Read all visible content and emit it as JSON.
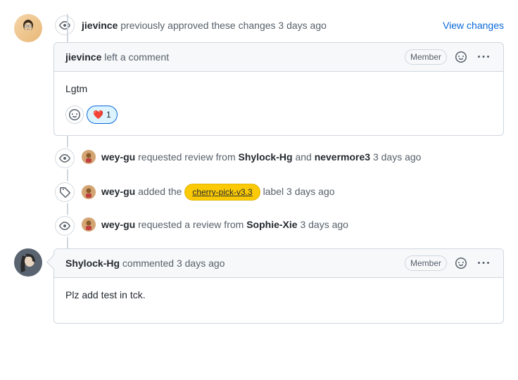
{
  "review1": {
    "user": "jievince",
    "action": "previously approved these changes",
    "timestamp": "3 days ago",
    "view_changes": "View changes",
    "comment_action": "left a comment",
    "member_label": "Member",
    "body": "Lgtm",
    "reaction_emoji": "❤️",
    "reaction_count": "1"
  },
  "event1": {
    "user": "wey-gu",
    "action_pre": "requested review from",
    "reviewers": [
      "Shylock-Hg",
      "nevermore3"
    ],
    "and": "and",
    "timestamp": "3 days ago"
  },
  "event2": {
    "user": "wey-gu",
    "action_pre": "added the",
    "label_name": "cherry-pick-v3.3",
    "action_post": "label",
    "timestamp": "3 days ago"
  },
  "event3": {
    "user": "wey-gu",
    "action_pre": "requested a review from",
    "reviewer": "Sophie-Xie",
    "timestamp": "3 days ago"
  },
  "comment2": {
    "user": "Shylock-Hg",
    "action": "commented",
    "timestamp": "3 days ago",
    "member_label": "Member",
    "body": "Plz add test in tck."
  }
}
